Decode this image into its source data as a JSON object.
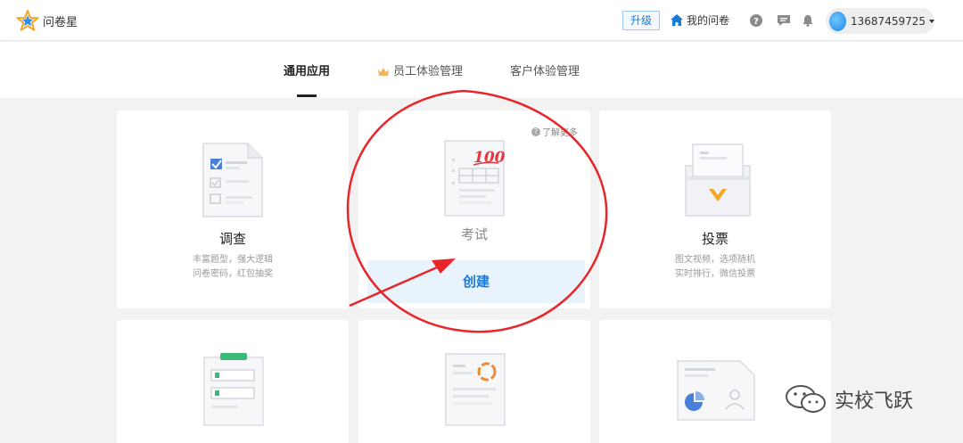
{
  "header": {
    "logo_text": "问卷星",
    "upgrade_label": "升级",
    "my_surveys_label": "我的问卷",
    "username": "13687459725"
  },
  "tabs": [
    {
      "label": "通用应用",
      "active": true
    },
    {
      "label": "员工体验管理",
      "icon": "crown-icon"
    },
    {
      "label": "客户体验管理"
    }
  ],
  "cards": [
    {
      "title": "调查",
      "desc": [
        "丰富题型，强大逻辑",
        "问卷密码，红包抽奖"
      ]
    },
    {
      "title": "考试",
      "learn_more": "了解更多",
      "create_label": "创建"
    },
    {
      "title": "投票",
      "desc": [
        "图文视频，选项随机",
        "实时排行，微信投票"
      ]
    }
  ],
  "exam_score": "100",
  "watermark": "实校飞跃",
  "colors": {
    "accent": "#1b7ad8",
    "annotation": "#e8262a"
  }
}
